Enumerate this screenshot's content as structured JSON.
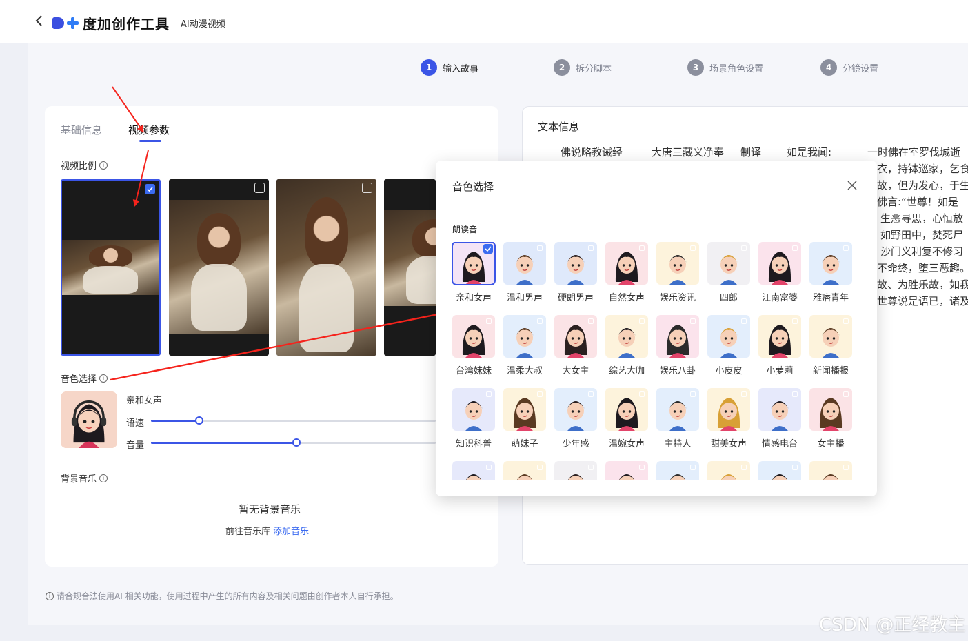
{
  "header": {
    "back_icon": "chevron-left-icon",
    "brand": "度加创作工具",
    "subtitle": "AI动漫视频"
  },
  "steps": [
    {
      "num": "1",
      "label": "输入故事",
      "active": true
    },
    {
      "num": "2",
      "label": "拆分脚本",
      "active": false
    },
    {
      "num": "3",
      "label": "场景角色设置",
      "active": false
    },
    {
      "num": "4",
      "label": "分镜设置",
      "active": false
    }
  ],
  "tabs": [
    {
      "label": "基础信息",
      "active": false
    },
    {
      "label": "视频参数",
      "active": true
    }
  ],
  "video_ratio": {
    "label": "视频比例",
    "selected_index": 0
  },
  "voice": {
    "label": "音色选择",
    "current_name": "亲和女声",
    "speed_label": "语速",
    "volume_label": "音量",
    "speed_percent": 17,
    "volume_percent": 51
  },
  "bgm": {
    "label": "背景音乐",
    "empty_text": "暂无背景音乐",
    "goto_text": "前往音乐库",
    "add_link": "添加音乐"
  },
  "footer_note": "请合规合法使用AI 相关功能，使用过程中产生的所有内容及相关问题由创作者本人自行承担。",
  "text_info": {
    "title": "文本信息",
    "heading": [
      "佛说略教诫经",
      "大唐三藏义净奉",
      "制译",
      "如是我闻:",
      "一时佛在室罗伐城逝"
    ],
    "lines": [
      "衣，持钵巡家，乞食",
      "故，但为发心，于生",
      "佛言:“世尊！如是",
      "生恶寻思，心恒放",
      "如野田中，焚死尸",
      "沙门义利复不修习",
      "不命终，堕三恶趣。",
      "故、为胜乐故，如我",
      "世尊说是语已，诸及"
    ]
  },
  "modal": {
    "title": "音色选择",
    "section": "朗读音",
    "selected": "亲和女声",
    "voices": [
      {
        "name": "亲和女声",
        "bg": "#f4e4f6"
      },
      {
        "name": "温和男声",
        "bg": "#dfe9fb"
      },
      {
        "name": "硬朗男声",
        "bg": "#dfe9fb"
      },
      {
        "name": "自然女声",
        "bg": "#fbe3e6"
      },
      {
        "name": "娱乐资讯",
        "bg": "#fdf3dc"
      },
      {
        "name": "四郎",
        "bg": "#f1f0f3"
      },
      {
        "name": "江南富婆",
        "bg": "#fbe3ec"
      },
      {
        "name": "雅痞青年",
        "bg": "#e3eefc"
      },
      {
        "name": "台湾妹妹",
        "bg": "#fbe3e6"
      },
      {
        "name": "温柔大叔",
        "bg": "#e3eefc"
      },
      {
        "name": "大女主",
        "bg": "#fbe3e6"
      },
      {
        "name": "综艺大咖",
        "bg": "#fdf3dc"
      },
      {
        "name": "娱乐八卦",
        "bg": "#fbe3ec"
      },
      {
        "name": "小皮皮",
        "bg": "#e3eefc"
      },
      {
        "name": "小萝莉",
        "bg": "#fdf3dc"
      },
      {
        "name": "新闻播报",
        "bg": "#fdf3dc"
      },
      {
        "name": "知识科普",
        "bg": "#e6e9fb"
      },
      {
        "name": "萌妹子",
        "bg": "#fdf3dc"
      },
      {
        "name": "少年感",
        "bg": "#e3eefc"
      },
      {
        "name": "温婉女声",
        "bg": "#fdf3dc"
      },
      {
        "name": "主持人",
        "bg": "#e3eefc"
      },
      {
        "name": "甜美女声",
        "bg": "#fdf3dc"
      },
      {
        "name": "情感电台",
        "bg": "#e6e9fb"
      },
      {
        "name": "女主播",
        "bg": "#fbe3e6"
      },
      {
        "name": "",
        "bg": "#e6e9fb"
      },
      {
        "name": "",
        "bg": "#fdf3dc"
      },
      {
        "name": "",
        "bg": "#f1f0f3"
      },
      {
        "name": "",
        "bg": "#fbe3ec"
      },
      {
        "name": "",
        "bg": "#e3eefc"
      },
      {
        "name": "",
        "bg": "#fdf3dc"
      },
      {
        "name": "",
        "bg": "#e3eefc"
      },
      {
        "name": "",
        "bg": "#fdf3dc"
      }
    ]
  },
  "watermark": "CSDN @正经教主",
  "colors": {
    "accent": "#3b55e6",
    "arrow": "#f5231c"
  }
}
